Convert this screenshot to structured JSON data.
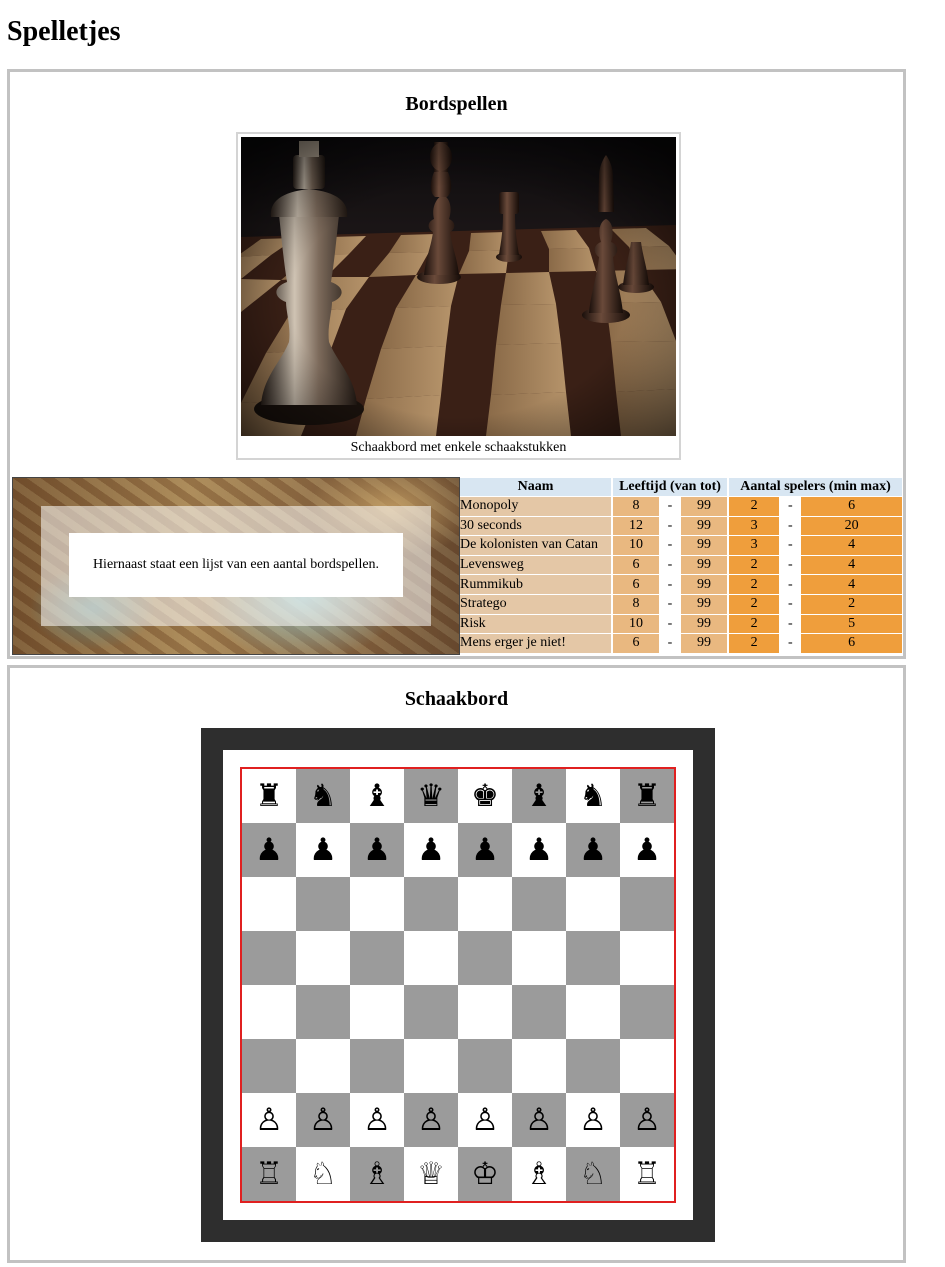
{
  "page_title": "Spelletjes",
  "board_games": {
    "heading": "Bordspellen",
    "caption": "Schaakbord met enkele schaakstukken",
    "notice": "Hiernaast staat een lijst van een aantal bordspellen.",
    "table": {
      "headers": [
        "Naam",
        "Leeftijd (van tot)",
        "Aantal spelers (min max)"
      ],
      "dash": "-",
      "rows": [
        {
          "naam": "Monopoly",
          "van": "8",
          "tot": "99",
          "min": "2",
          "max": "6"
        },
        {
          "naam": "30 seconds",
          "van": "12",
          "tot": "99",
          "min": "3",
          "max": "20"
        },
        {
          "naam": "De kolonisten van Catan",
          "van": "10",
          "tot": "99",
          "min": "3",
          "max": "4"
        },
        {
          "naam": "Levensweg",
          "van": "6",
          "tot": "99",
          "min": "2",
          "max": "4"
        },
        {
          "naam": "Rummikub",
          "van": "6",
          "tot": "99",
          "min": "2",
          "max": "4"
        },
        {
          "naam": "Stratego",
          "van": "8",
          "tot": "99",
          "min": "2",
          "max": "2"
        },
        {
          "naam": "Risk",
          "van": "10",
          "tot": "99",
          "min": "2",
          "max": "5"
        },
        {
          "naam": "Mens erger je niet!",
          "van": "6",
          "tot": "99",
          "min": "2",
          "max": "6"
        }
      ]
    }
  },
  "chess": {
    "heading": "Schaakbord",
    "ranks": [
      [
        "♜",
        "♞",
        "♝",
        "♛",
        "♚",
        "♝",
        "♞",
        "♜"
      ],
      [
        "♟",
        "♟",
        "♟",
        "♟",
        "♟",
        "♟",
        "♟",
        "♟"
      ],
      [
        "",
        "",
        "",
        "",
        "",
        "",
        "",
        ""
      ],
      [
        "",
        "",
        "",
        "",
        "",
        "",
        "",
        ""
      ],
      [
        "",
        "",
        "",
        "",
        "",
        "",
        "",
        ""
      ],
      [
        "",
        "",
        "",
        "",
        "",
        "",
        "",
        ""
      ],
      [
        "♙",
        "♙",
        "♙",
        "♙",
        "♙",
        "♙",
        "♙",
        "♙"
      ],
      [
        "♖",
        "♘",
        "♗",
        "♕",
        "♔",
        "♗",
        "♘",
        "♖"
      ]
    ]
  },
  "colors": {
    "board_dark": "#9b9b9b",
    "board_light": "#ffffff",
    "board_border": "#e02020",
    "frame": "#2e2e2e",
    "header_bg": "#d8e6f2",
    "name_bg": "#e4c7a6",
    "age_bg": "#e9b880",
    "players_bg": "#ef9e3c"
  }
}
